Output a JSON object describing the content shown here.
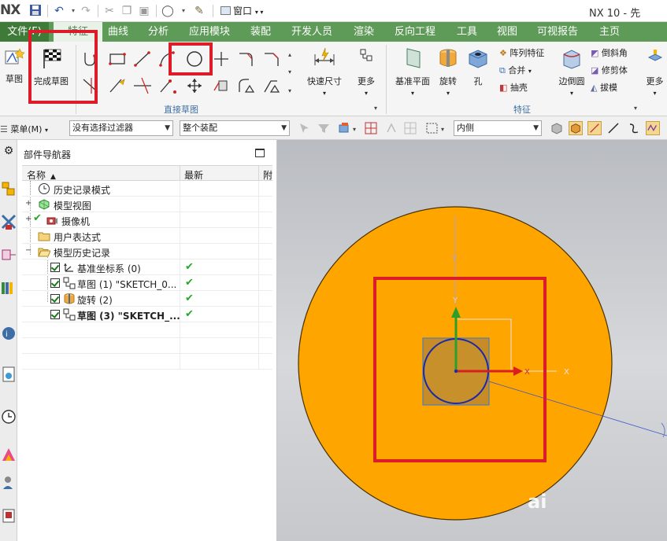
{
  "titlebar": {
    "logo": "NX",
    "window_menu": "窗口",
    "app_title": "NX 10 - 先"
  },
  "tabs": [
    {
      "label": "文件(F)"
    },
    {
      "label": "特征"
    },
    {
      "label": "曲线"
    },
    {
      "label": "分析"
    },
    {
      "label": "应用模块"
    },
    {
      "label": "装配"
    },
    {
      "label": "开发人员"
    },
    {
      "label": "渲染"
    },
    {
      "label": "反向工程"
    },
    {
      "label": "工具"
    },
    {
      "label": "视图"
    },
    {
      "label": "可视报告"
    },
    {
      "label": "主页"
    }
  ],
  "ribbon": {
    "sketch_label": "草图",
    "finish_sketch_label": "完成草图",
    "direct_sketch_group": "直接草图",
    "quick_dimension_label": "快速尺寸",
    "more_label_1": "更多",
    "datum_plane_label": "基准平面",
    "revolve_label": "旋转",
    "hole_label": "孔",
    "pattern_feature_label": "阵列特征",
    "unite_label": "合并",
    "shell_label": "抽壳",
    "edge_blend_label": "边倒圆",
    "chamfer_label": "倒斜角",
    "trim_body_label": "修剪体",
    "draft_label": "拔模",
    "more_label_2": "更多",
    "feature_group": "特征"
  },
  "filterbar": {
    "menu_label": "菜单(M)",
    "selection_filter": "没有选择过滤器",
    "assembly_scope": "整个装配",
    "inside_option": "内侧"
  },
  "navigator": {
    "title": "部件导航器",
    "col_name": "名称",
    "col_latest": "最新",
    "col_third": "附",
    "rows": [
      {
        "label": "历史记录模式",
        "latest": ""
      },
      {
        "label": "模型视图",
        "latest": ""
      },
      {
        "label": "摄像机",
        "latest": ""
      },
      {
        "label": "用户表达式",
        "latest": ""
      },
      {
        "label": "模型历史记录",
        "latest": ""
      },
      {
        "label": "基准坐标系 (0)",
        "latest": "✔"
      },
      {
        "label": "草图 (1) \"SKETCH_0...",
        "latest": "✔"
      },
      {
        "label": "旋转 (2)",
        "latest": "✔"
      },
      {
        "label": "草图 (3) \"SKETCH_...",
        "latest": "✔"
      }
    ]
  },
  "viewport": {
    "axis_y": "Y",
    "axis_x": "X",
    "axis_x2": "X",
    "axis_y2": "Y",
    "watermark": "ai"
  },
  "colors": {
    "tab_bar": "#5e9a58",
    "highlight": "#dd1c2a",
    "disc": "#ffa500"
  }
}
